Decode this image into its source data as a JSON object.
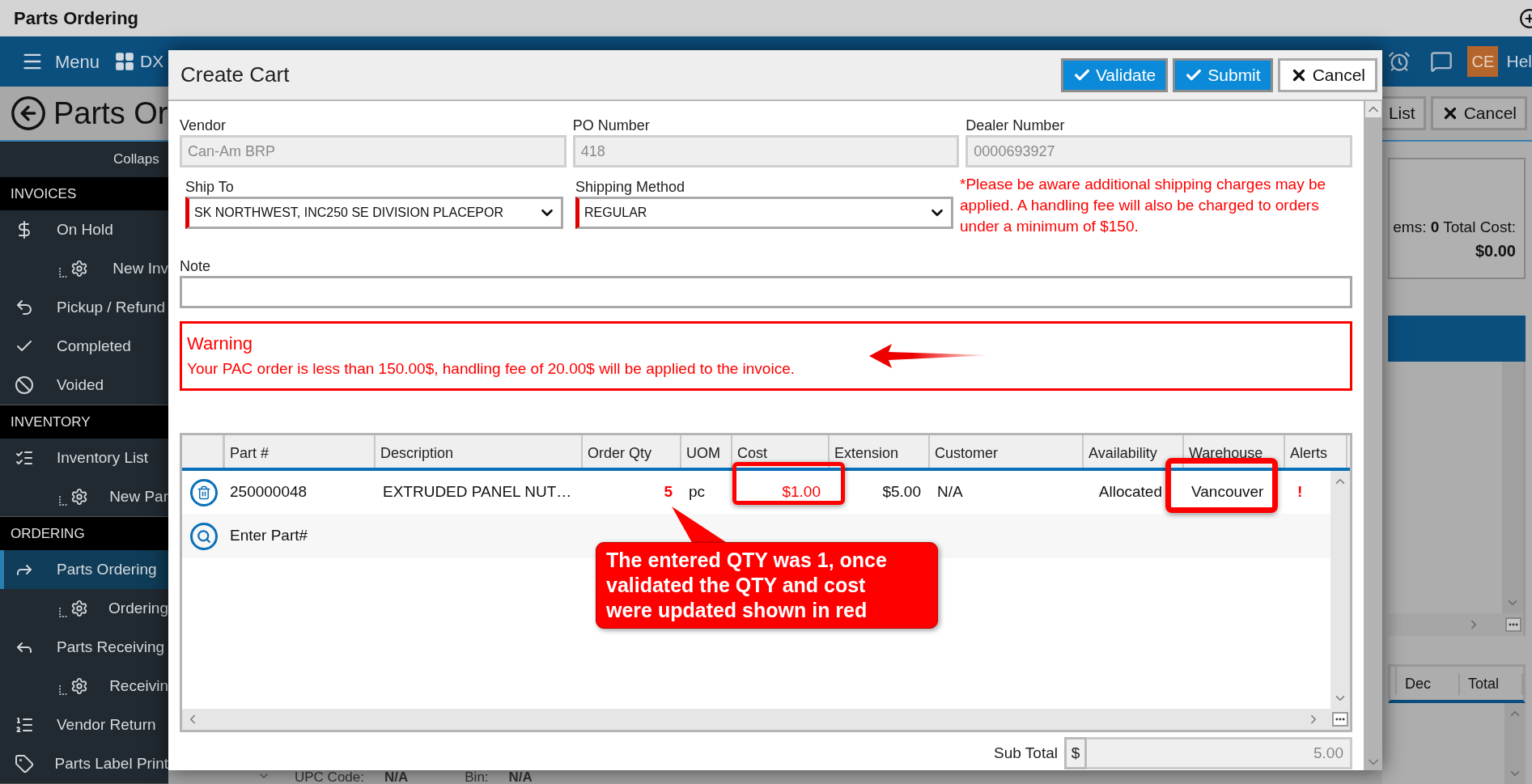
{
  "window": {
    "title": "Parts Ordering"
  },
  "app_bar": {
    "menu_label": "Menu",
    "dx_label": "DX",
    "avatar": "CE",
    "help": "Hel"
  },
  "page_header": {
    "title": "Parts Or",
    "buttons": [
      {
        "label": "List",
        "kind": "plain"
      },
      {
        "label": "Cancel",
        "kind": "cancel"
      }
    ]
  },
  "sidebar": {
    "collapse": "Collaps",
    "sections": [
      {
        "title": "INVOICES",
        "items": [
          {
            "label": "On Hold",
            "selected": false,
            "children": [
              {
                "label": "New Inv",
                "selected": false
              }
            ]
          },
          {
            "label": "Pickup / Refund",
            "selected": false
          },
          {
            "label": "Completed",
            "selected": false
          },
          {
            "label": "Voided",
            "selected": false
          }
        ]
      },
      {
        "title": "INVENTORY",
        "items": [
          {
            "label": "Inventory List",
            "selected": false,
            "children": [
              {
                "label": "New Par",
                "selected": false
              }
            ]
          }
        ]
      },
      {
        "title": "ORDERING",
        "items": [
          {
            "label": "Parts Ordering",
            "selected": true,
            "children": [
              {
                "label": "Ordering",
                "selected": false
              }
            ]
          },
          {
            "label": "Parts Receiving",
            "selected": false,
            "children": [
              {
                "label": "Receivin",
                "selected": false
              }
            ]
          },
          {
            "label": "Vendor Return",
            "selected": false
          },
          {
            "label": "Parts Label Print",
            "selected": false
          }
        ]
      }
    ]
  },
  "summary": {
    "text": "ems: **0** Total Cost:",
    "total": "$0.00"
  },
  "background_table": {
    "columns": [
      "Dec",
      "Total"
    ]
  },
  "footer_fields": [
    {
      "label": "UPC Code:",
      "value": "N/A"
    },
    {
      "label": "Bin:",
      "value": "N/A"
    }
  ],
  "dialog": {
    "title": "Create Cart",
    "buttons": [
      {
        "label": "Validate",
        "kind": "primary"
      },
      {
        "label": "Submit",
        "kind": "primary"
      },
      {
        "label": "Cancel",
        "kind": "cancel"
      }
    ],
    "fields": [
      {
        "label": "Vendor",
        "value": "Can-Am BRP",
        "disabled": true
      },
      {
        "label": "PO Number",
        "value": "418",
        "disabled": true
      },
      {
        "label": "Dealer Number",
        "value": "0000693927",
        "disabled": true
      }
    ],
    "selects": [
      {
        "label": "Ship To",
        "value": "SK NORTHWEST, INC250 SE DIVISION PLACEPOR",
        "required": true
      },
      {
        "label": "Shipping Method",
        "value": "REGULAR",
        "required": true
      }
    ],
    "shipping_notice": "*Please be aware additional shipping charges may be applied. A handling fee will also be charged to orders under a minimum of $150.",
    "note": {
      "label": "Note"
    },
    "warning": {
      "title": "Warning",
      "message": "Your PAC order is less than 150.00$, handling fee of 20.00$ will be applied to the invoice."
    },
    "table": {
      "columns": [
        "Part #",
        "Description",
        "Order Qty",
        "UOM",
        "Cost",
        "Extension",
        "Customer",
        "Availability",
        "Warehouse",
        "Alerts"
      ],
      "rows": [
        {
          "cells": [
            {
              "text": "250000048",
              "updated": false
            },
            {
              "text": "EXTRUDED PANEL NUT…",
              "updated": false
            },
            {
              "text": "5",
              "updated": true
            },
            {
              "text": "pc",
              "updated": false
            },
            {
              "text": "$1.00",
              "updated": true
            },
            {
              "text": "$5.00",
              "updated": false
            },
            {
              "text": "N/A",
              "updated": false
            },
            {
              "text": "Allocated",
              "updated": false
            },
            {
              "text": "Vancouver",
              "updated": false
            },
            {
              "text": "!",
              "updated": true
            }
          ]
        }
      ],
      "new_part": {
        "placeholder": "Enter Part#"
      }
    },
    "subtotal": {
      "label": "Sub Total",
      "currency": "$",
      "value": "5.00"
    },
    "callout": "The entered QTY was 1, once validated the QTY and cost were updated shown in red"
  }
}
